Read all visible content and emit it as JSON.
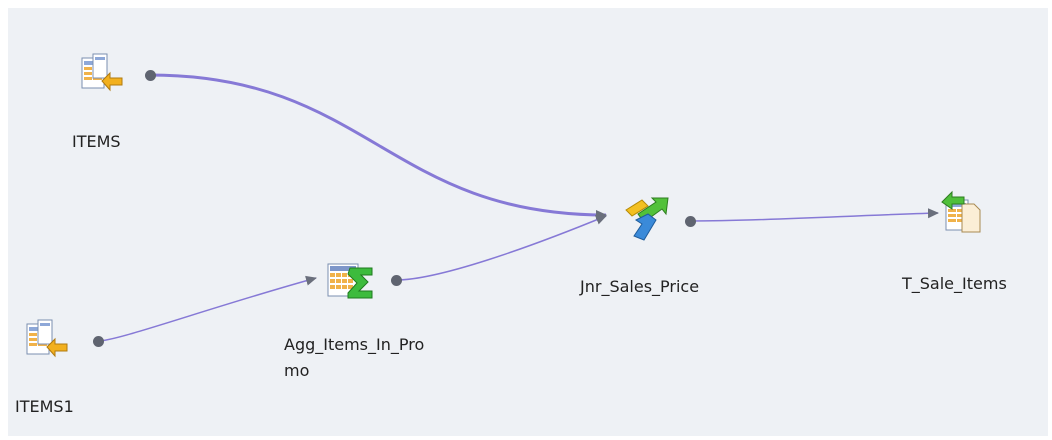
{
  "colors": {
    "canvas": "#eef1f5",
    "edge": "#8679d6",
    "port": "#5f6470"
  },
  "nodes": {
    "items": {
      "label": "ITEMS",
      "icon": "source-table-icon"
    },
    "items1": {
      "label": "ITEMS1",
      "icon": "source-table-icon"
    },
    "agg": {
      "label": "Agg_Items_In_Promo",
      "icon": "aggregator-icon"
    },
    "jnr": {
      "label": "Jnr_Sales_Price",
      "icon": "joiner-icon"
    },
    "target": {
      "label": "T_Sale_Items",
      "icon": "target-table-icon"
    }
  },
  "links": [
    {
      "from": "ITEMS",
      "to": "Jnr_Sales_Price"
    },
    {
      "from": "ITEMS1",
      "to": "Agg_Items_In_Promo"
    },
    {
      "from": "Agg_Items_In_Promo",
      "to": "Jnr_Sales_Price"
    },
    {
      "from": "Jnr_Sales_Price",
      "to": "T_Sale_Items"
    }
  ]
}
